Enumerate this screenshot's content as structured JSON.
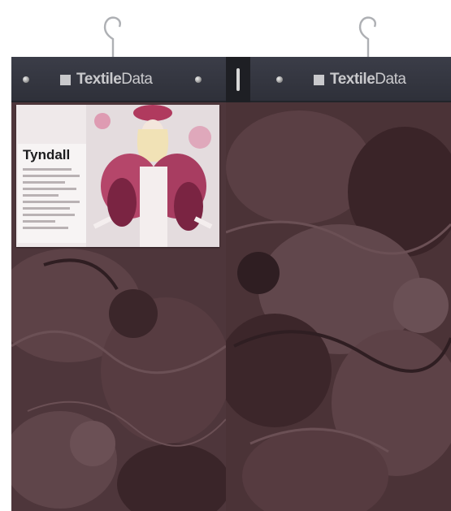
{
  "headers": [
    {
      "brand_bold": "Textile",
      "brand_light": "Data"
    },
    {
      "brand_bold": "Textile",
      "brand_light": "Data"
    }
  ],
  "label": {
    "title": "Tyndall"
  },
  "colors": {
    "header": "#2e3039",
    "fabric_base": "#4e363b",
    "fabric_highlight": "#6b5055",
    "fabric_shadow": "#2f1e22",
    "accent_pink": "#d85a86"
  },
  "icons": [
    "hanger-hook-icon",
    "grommet-icon",
    "textiledata-logo-icon"
  ]
}
